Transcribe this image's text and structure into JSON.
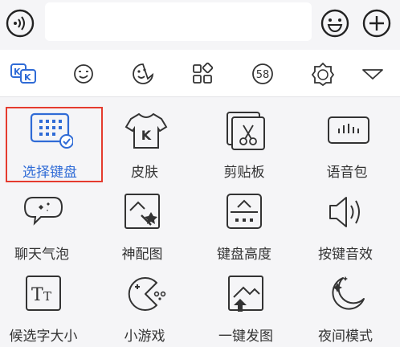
{
  "toolbar": {
    "voice_icon": "voice-icon",
    "input_placeholder": "",
    "emoji_icon": "smiley-icon",
    "plus_icon": "plus-icon"
  },
  "tabs": [
    {
      "icon": "kk-keyboard-icon",
      "active": true
    },
    {
      "icon": "emoji-face-icon"
    },
    {
      "icon": "sticker-face-icon"
    },
    {
      "icon": "apps-grid-icon"
    },
    {
      "icon": "number-58-icon",
      "text": "58"
    },
    {
      "icon": "badge-icon"
    },
    {
      "icon": "triangle-down-icon"
    }
  ],
  "grid": {
    "items": [
      {
        "label": "选择键盘",
        "icon": "keyboard-select-icon",
        "selected": true
      },
      {
        "label": "皮肤",
        "icon": "tshirt-k-icon"
      },
      {
        "label": "剪贴板",
        "icon": "scissors-clipboard-icon"
      },
      {
        "label": "语音包",
        "icon": "voice-pack-icon"
      },
      {
        "label": "聊天气泡",
        "icon": "chat-bubble-icon"
      },
      {
        "label": "神配图",
        "icon": "magic-image-icon"
      },
      {
        "label": "键盘高度",
        "icon": "keyboard-height-icon"
      },
      {
        "label": "按键音效",
        "icon": "speaker-icon"
      },
      {
        "label": "候选字大小",
        "icon": "text-size-icon"
      },
      {
        "label": "小游戏",
        "icon": "pacman-game-icon"
      },
      {
        "label": "一键发图",
        "icon": "send-image-icon"
      },
      {
        "label": "夜间模式",
        "icon": "moon-icon"
      }
    ]
  },
  "colors": {
    "accent": "#2f6bd6",
    "highlight_border": "#e53b2e",
    "icon": "#333333"
  }
}
